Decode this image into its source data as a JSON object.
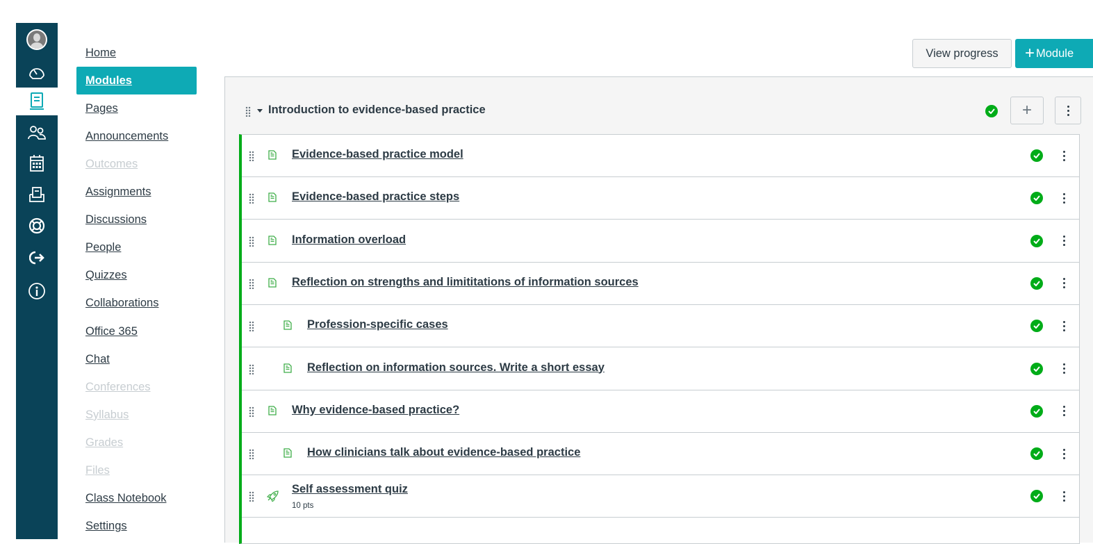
{
  "global_nav": {
    "items": [
      {
        "name": "account",
        "icon": "avatar-icon"
      },
      {
        "name": "dashboard",
        "icon": "dashboard-icon"
      },
      {
        "name": "courses",
        "icon": "courses-icon",
        "active": true
      },
      {
        "name": "groups",
        "icon": "groups-icon"
      },
      {
        "name": "calendar",
        "icon": "calendar-icon"
      },
      {
        "name": "inbox",
        "icon": "inbox-icon"
      },
      {
        "name": "help",
        "icon": "help-icon"
      },
      {
        "name": "logout",
        "icon": "logout-icon"
      },
      {
        "name": "info",
        "icon": "info-icon"
      }
    ],
    "background": "#0a4358"
  },
  "course_nav": {
    "items": [
      {
        "label": "Home"
      },
      {
        "label": "Modules",
        "active": true
      },
      {
        "label": "Pages"
      },
      {
        "label": "Announcements"
      },
      {
        "label": "Outcomes",
        "disabled": true
      },
      {
        "label": "Assignments"
      },
      {
        "label": "Discussions"
      },
      {
        "label": "People"
      },
      {
        "label": "Quizzes"
      },
      {
        "label": "Collaborations"
      },
      {
        "label": "Office 365"
      },
      {
        "label": "Chat"
      },
      {
        "label": "Conferences",
        "disabled": true
      },
      {
        "label": "Syllabus",
        "disabled": true
      },
      {
        "label": "Grades",
        "disabled": true
      },
      {
        "label": "Files",
        "disabled": true
      },
      {
        "label": "Class Notebook"
      },
      {
        "label": "Settings"
      }
    ],
    "active_color": "#0eaab5"
  },
  "header": {
    "view_progress_label": "View progress",
    "add_module_label": "Module"
  },
  "module": {
    "title": "Introduction to evidence-based practice",
    "published": true,
    "items": [
      {
        "title": "Evidence-based practice model",
        "type": "page",
        "indent": 0,
        "published": true
      },
      {
        "title": "Evidence-based practice steps",
        "type": "page",
        "indent": 0,
        "published": true
      },
      {
        "title": "Information overload",
        "type": "page",
        "indent": 0,
        "published": true
      },
      {
        "title": "Reflection on strengths and limititations of information sources",
        "type": "page",
        "indent": 0,
        "published": true
      },
      {
        "title": "Profession-specific cases",
        "type": "page",
        "indent": 1,
        "published": true
      },
      {
        "title": "Reflection on information sources. Write a short essay",
        "type": "page",
        "indent": 1,
        "published": true
      },
      {
        "title": "Why evidence-based practice?",
        "type": "page",
        "indent": 0,
        "published": true
      },
      {
        "title": "How clinicians talk about evidence-based practice",
        "type": "page",
        "indent": 1,
        "published": true
      },
      {
        "title": "Self assessment quiz",
        "type": "quiz",
        "indent": 0,
        "published": true,
        "points": "10 pts"
      }
    ]
  },
  "colors": {
    "published_green": "#00ac18",
    "page_icon_green": "#3fae49"
  }
}
